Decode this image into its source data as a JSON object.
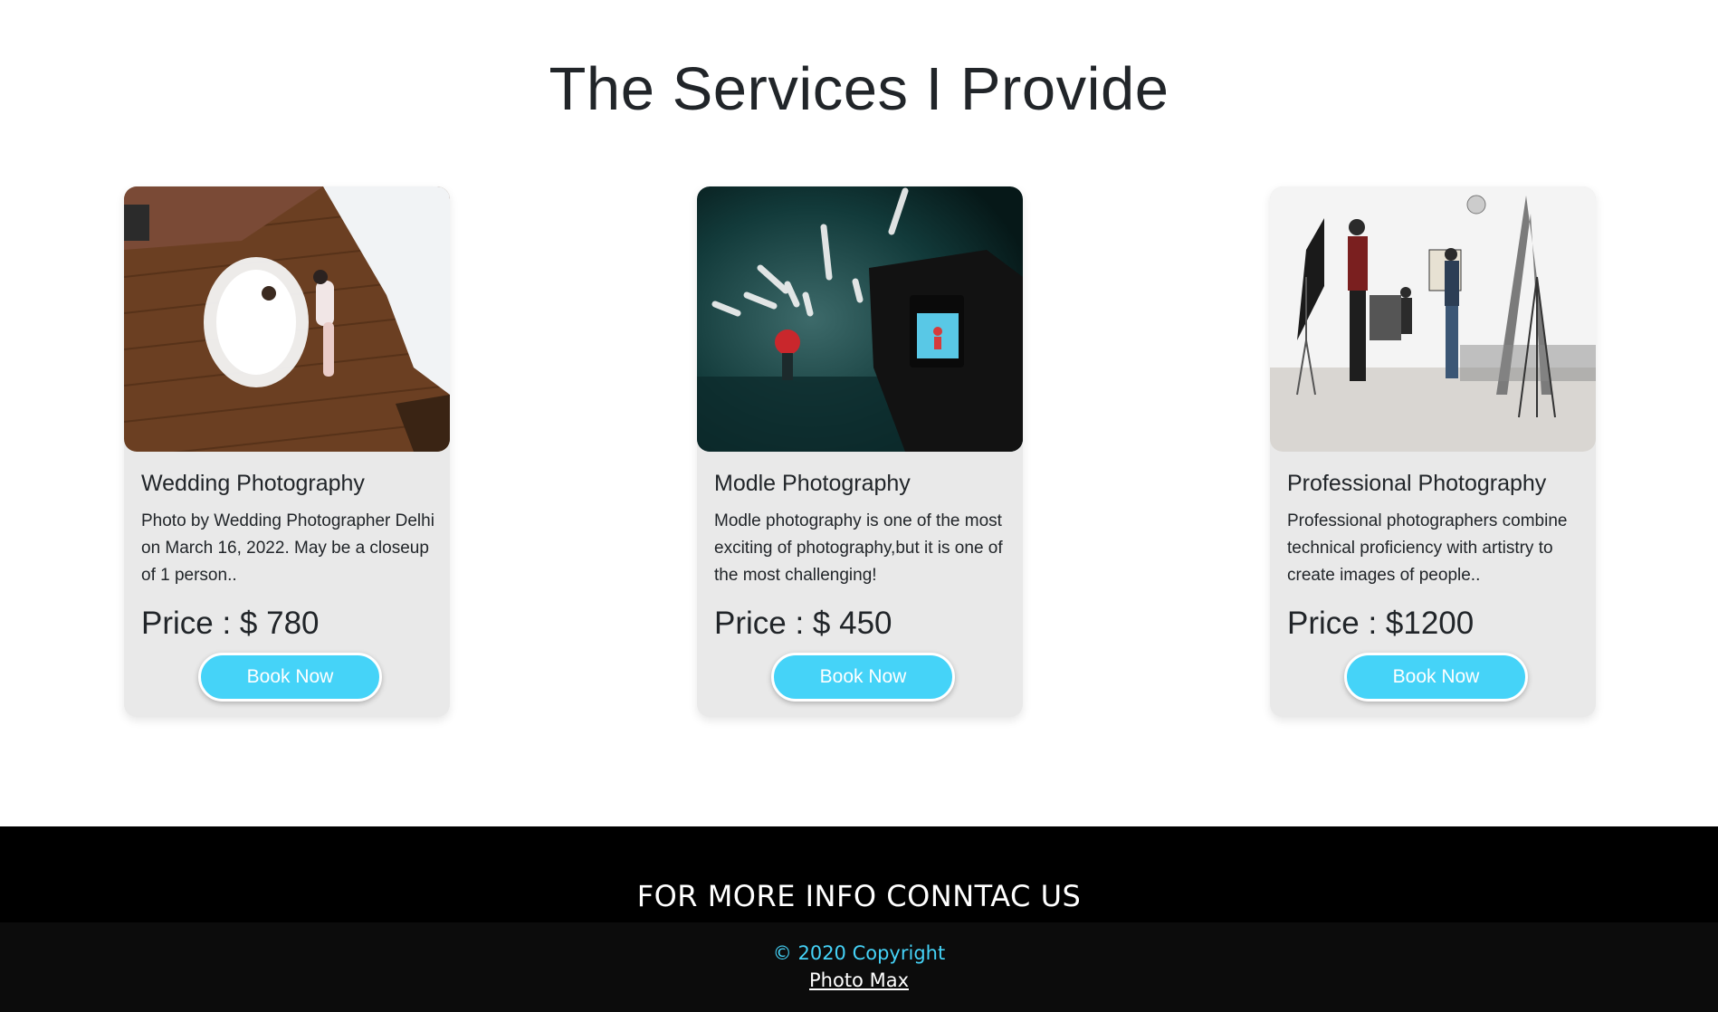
{
  "services": {
    "title": "The Services I Provide",
    "cards": [
      {
        "title": "Wedding Photography",
        "description": "Photo by Wedding Photographer Delhi on March 16, 2022. May be a closeup of 1 person..",
        "price": "Price : $ 780",
        "button_label": "Book Now"
      },
      {
        "title": "Modle Photography",
        "description": "Modle photography is one of the most exciting of photography,but it is one of the most challenging!",
        "price": "Price : $ 450",
        "button_label": "Book Now"
      },
      {
        "title": "Professional Photography",
        "description": "Professional photographers combine technical proficiency with artistry to create images of people..",
        "price": "Price : $1200",
        "button_label": "Book Now"
      }
    ]
  },
  "footer": {
    "heading": "FOR MORE INFO CONNTAC US",
    "copyright": "© 2020 Copyright",
    "brand": "Photo Max"
  },
  "colors": {
    "accent": "#45d3f8",
    "card_bg": "#e9e9e9",
    "footer_top": "#000000",
    "footer_bottom": "#0c0c0c"
  }
}
